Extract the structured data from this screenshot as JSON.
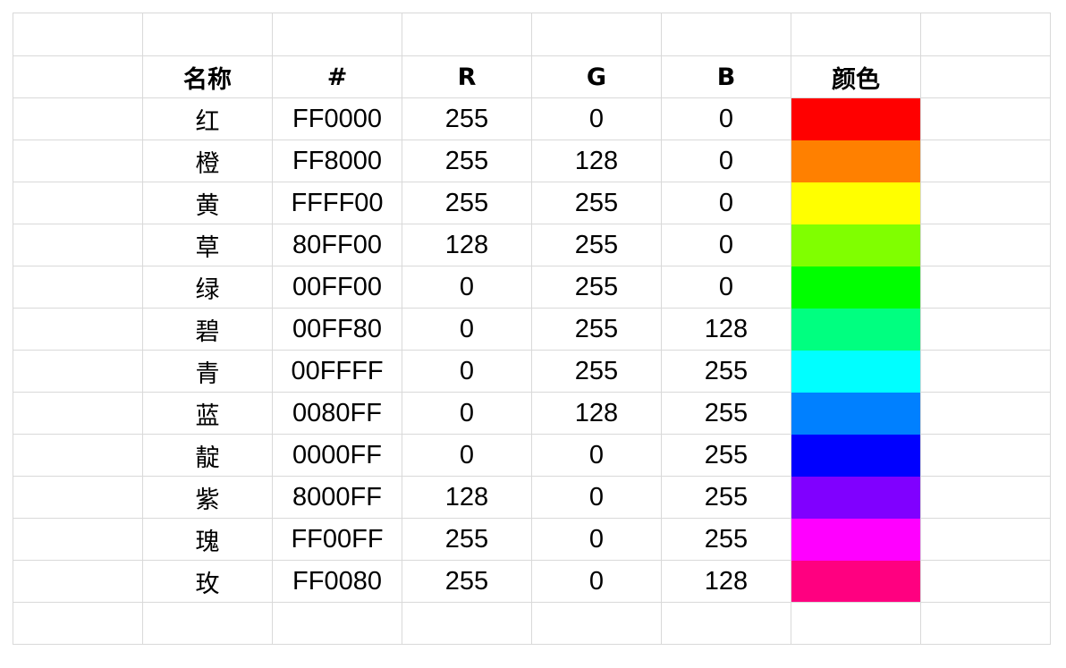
{
  "table": {
    "headers": [
      "名称",
      "#",
      "R",
      "G",
      "B",
      "颜色"
    ],
    "rows": [
      {
        "name": "红",
        "hex": "FF0000",
        "r": "255",
        "g": "0",
        "b": "0",
        "color": "#FF0000"
      },
      {
        "name": "橙",
        "hex": "FF8000",
        "r": "255",
        "g": "128",
        "b": "0",
        "color": "#FF8000"
      },
      {
        "name": "黄",
        "hex": "FFFF00",
        "r": "255",
        "g": "255",
        "b": "0",
        "color": "#FFFF00"
      },
      {
        "name": "草",
        "hex": "80FF00",
        "r": "128",
        "g": "255",
        "b": "0",
        "color": "#80FF00"
      },
      {
        "name": "绿",
        "hex": "00FF00",
        "r": "0",
        "g": "255",
        "b": "0",
        "color": "#00FF00"
      },
      {
        "name": "碧",
        "hex": "00FF80",
        "r": "0",
        "g": "255",
        "b": "128",
        "color": "#00FF80"
      },
      {
        "name": "青",
        "hex": "00FFFF",
        "r": "0",
        "g": "255",
        "b": "255",
        "color": "#00FFFF"
      },
      {
        "name": "蓝",
        "hex": "0080FF",
        "r": "0",
        "g": "128",
        "b": "255",
        "color": "#0080FF"
      },
      {
        "name": "靛",
        "hex": "0000FF",
        "r": "0",
        "g": "0",
        "b": "255",
        "color": "#0000FF"
      },
      {
        "name": "紫",
        "hex": "8000FF",
        "r": "128",
        "g": "0",
        "b": "255",
        "color": "#8000FF"
      },
      {
        "name": "瑰",
        "hex": "FF00FF",
        "r": "255",
        "g": "0",
        "b": "255",
        "color": "#FF00FF"
      },
      {
        "name": "玫",
        "hex": "FF0080",
        "r": "255",
        "g": "0",
        "b": "128",
        "color": "#FF0080"
      }
    ]
  },
  "grid": {
    "line_color": "#d9d9d9"
  }
}
